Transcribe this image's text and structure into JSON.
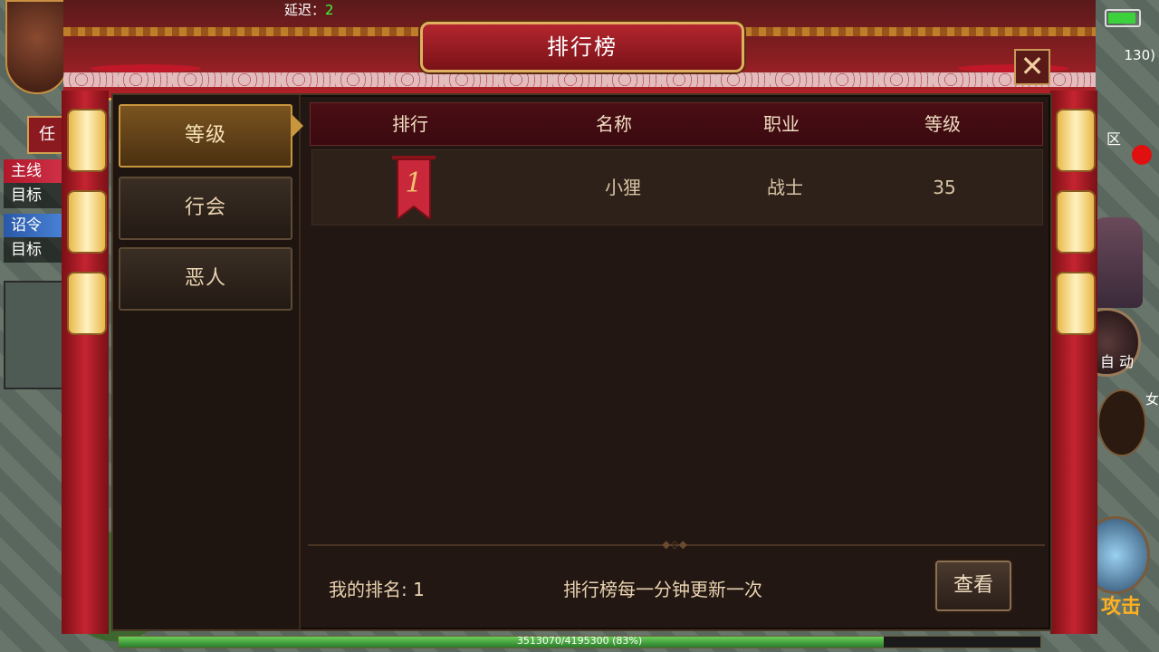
{
  "hud": {
    "latency_label": "延迟：",
    "latency_value": "2",
    "coord": "130)",
    "side_button": "任",
    "quest_main": "主线",
    "quest_order": "诏令",
    "quest_target_1": "目标",
    "quest_target_2": "目标",
    "zone": "区",
    "auto_label": "自 动",
    "attack_label": "攻击",
    "female_label": "女"
  },
  "exp": {
    "text": "3513070/4195300 (83%)",
    "fraction": 0.83
  },
  "window": {
    "title": "排行榜",
    "close_symbol": "✕"
  },
  "tabs": [
    {
      "label": "等级",
      "active": true
    },
    {
      "label": "行会",
      "active": false
    },
    {
      "label": "恶人",
      "active": false
    }
  ],
  "table": {
    "headers": [
      "排行",
      "名称",
      "职业",
      "等级"
    ],
    "rows": [
      {
        "rank": "1",
        "name": "小狸",
        "class": "战士",
        "level": "35"
      }
    ]
  },
  "footer": {
    "my_rank": "我的排名: 1",
    "update_note": "排行榜每一分钟更新一次",
    "view_button": "查看"
  },
  "colors": {
    "accent_red": "#b3262e",
    "gold": "#c8963e",
    "panel_bg": "#221712"
  }
}
